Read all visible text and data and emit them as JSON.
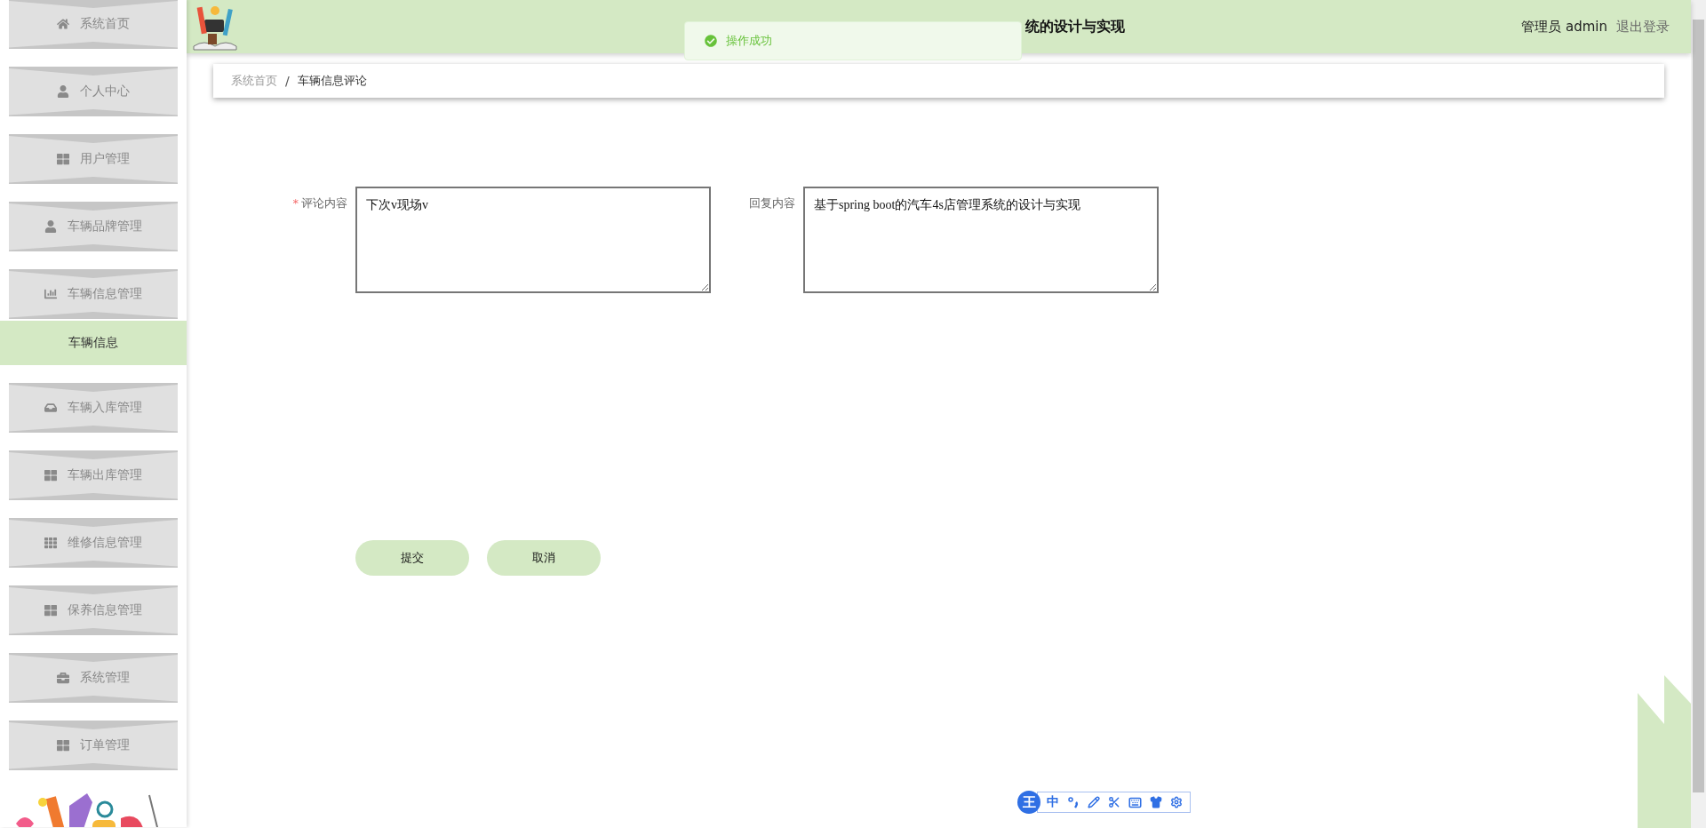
{
  "header": {
    "title": "统的设计与实现",
    "user": "管理员 admin",
    "logout": "退出登录"
  },
  "toast": {
    "message": "操作成功"
  },
  "sidebar": {
    "items": [
      {
        "label": "系统首页"
      },
      {
        "label": "个人中心"
      },
      {
        "label": "用户管理"
      },
      {
        "label": "车辆品牌管理"
      },
      {
        "label": "车辆信息管理",
        "children": [
          {
            "label": "车辆信息",
            "selected": true
          }
        ]
      },
      {
        "label": "车辆入库管理"
      },
      {
        "label": "车辆出库管理"
      },
      {
        "label": "维修信息管理"
      },
      {
        "label": "保养信息管理"
      },
      {
        "label": "系统管理"
      },
      {
        "label": "订单管理"
      }
    ]
  },
  "breadcrumb": {
    "items": [
      "系统首页",
      "车辆信息评论"
    ],
    "separator": "/"
  },
  "form": {
    "fields": [
      {
        "label": "评论内容",
        "required_mark": "*",
        "value": "下次v现场v"
      },
      {
        "label": "回复内容",
        "value": "基于spring boot的汽车4s店管理系统的设计与实现"
      }
    ],
    "buttons": [
      "提交",
      "取消"
    ]
  },
  "ime": {
    "logo": "王",
    "mode": "中"
  }
}
